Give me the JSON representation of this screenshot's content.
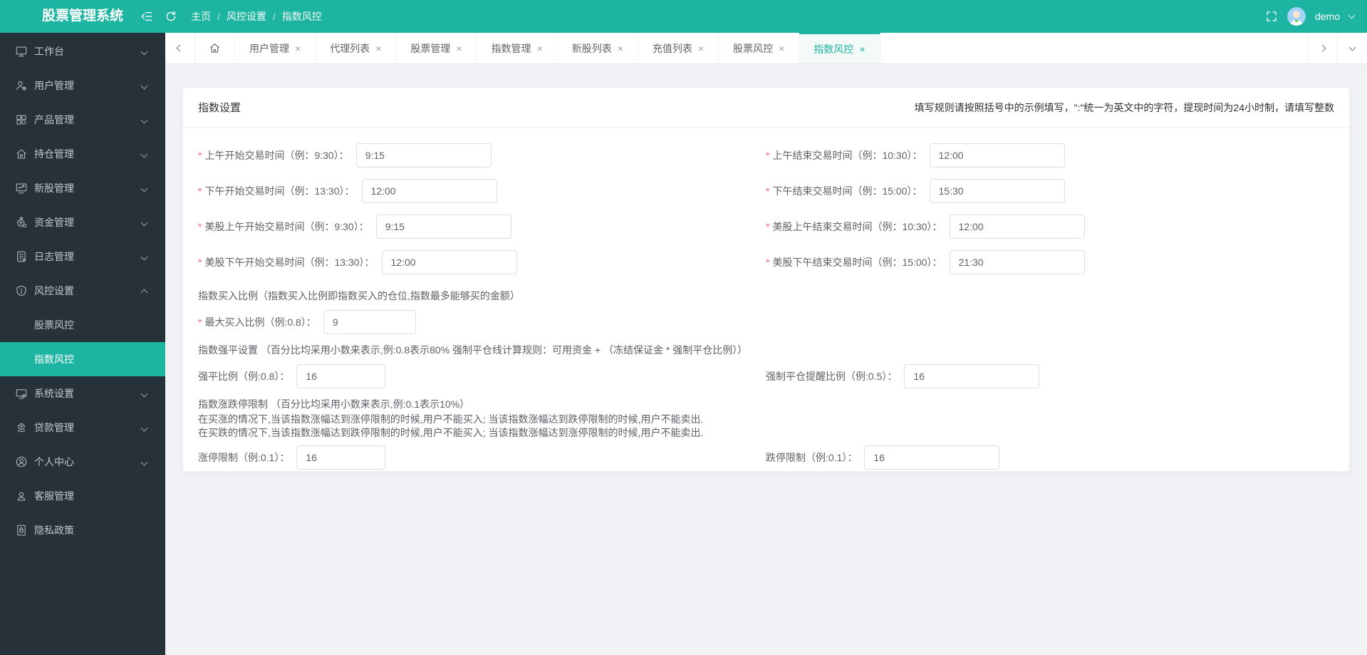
{
  "ui": {
    "required_mark": "*",
    "close_glyph": "×"
  },
  "header": {
    "app_title": "股票管理系统",
    "breadcrumb": {
      "items": [
        "主页",
        "风控设置",
        "指数风控"
      ],
      "separator": "/"
    },
    "user": {
      "name": "demo"
    }
  },
  "sidebar": {
    "items": [
      {
        "label": "工作台"
      },
      {
        "label": "用户管理"
      },
      {
        "label": "产品管理"
      },
      {
        "label": "持仓管理"
      },
      {
        "label": "新股管理"
      },
      {
        "label": "资金管理"
      },
      {
        "label": "日志管理"
      },
      {
        "label": "风控设置"
      },
      {
        "label": "系统设置"
      },
      {
        "label": "贷款管理"
      },
      {
        "label": "个人中心"
      },
      {
        "label": "客服管理"
      },
      {
        "label": "隐私政策"
      }
    ],
    "submenu": [
      {
        "label": "股票风控",
        "active": false
      },
      {
        "label": "指数风控",
        "active": true
      }
    ]
  },
  "tabbar": {
    "tabs": [
      {
        "label": "用户管理"
      },
      {
        "label": "代理列表"
      },
      {
        "label": "股票管理"
      },
      {
        "label": "指数管理"
      },
      {
        "label": "新股列表"
      },
      {
        "label": "充值列表"
      },
      {
        "label": "股票风控"
      },
      {
        "label": "指数风控",
        "active": true
      }
    ]
  },
  "page": {
    "card_title": "指数设置",
    "note": "填写规则请按照括号中的示例填写，\":\"统一为英文中的字符，提现时间为24小时制，请填写整数"
  },
  "form": {
    "time": {
      "left": [
        {
          "label": "上午开始交易时间（例：9:30）：",
          "value": "9:15"
        },
        {
          "label": "下午开始交易时间（例：13:30）：",
          "value": "12:00"
        },
        {
          "label": "美股上午开始交易时间（例：9:30）：",
          "value": "9:15"
        },
        {
          "label": "美股下午开始交易时间（例：13:30）：",
          "value": "12:00"
        }
      ],
      "right": [
        {
          "label": "上午结束交易时间（例：10:30）：",
          "value": "12:00"
        },
        {
          "label": "下午结束交易时间（例：15:00）：",
          "value": "15:30"
        },
        {
          "label": "美股上午结束交易时间（例：10:30）：",
          "value": "12:00"
        },
        {
          "label": "美股下午结束交易时间（例：15:00）：",
          "value": "21:30"
        }
      ]
    },
    "buy_section": {
      "heading": "指数买入比例（指数买入比例即指数买入的仓位,指数最多能够买的金额）",
      "field": {
        "label": "最大买入比例（例:0.8）：",
        "value": "9"
      }
    },
    "force_section": {
      "heading": "指数强平设置 （百分比均采用小数来表示,例:0.8表示80% 强制平仓线计算规则：可用资金 + （冻结保证金 * 强制平仓比例））",
      "left": {
        "label": "强平比例（例:0.8）：",
        "value": "16"
      },
      "right": {
        "label": "强制平仓提醒比例（例:0.5）：",
        "value": "16"
      }
    },
    "limit_section": {
      "heading": "指数涨跌停限制 （百分比均采用小数来表示,例:0.1表示10%）",
      "desc1": "在买涨的情况下,当该指数涨幅达到涨停限制的时候,用户不能买入; 当该指数涨幅达到跌停限制的时候,用户不能卖出.",
      "desc2": "在买跌的情况下,当该指数涨幅达到跌停限制的时候,用户不能买入; 当该指数涨幅达到涨停限制的时候,用户不能卖出.",
      "left": {
        "label": "涨停限制（例:0.1）：",
        "value": "16"
      },
      "right": {
        "label": "跌停限制（例:0.1）：",
        "value": "16"
      }
    }
  }
}
